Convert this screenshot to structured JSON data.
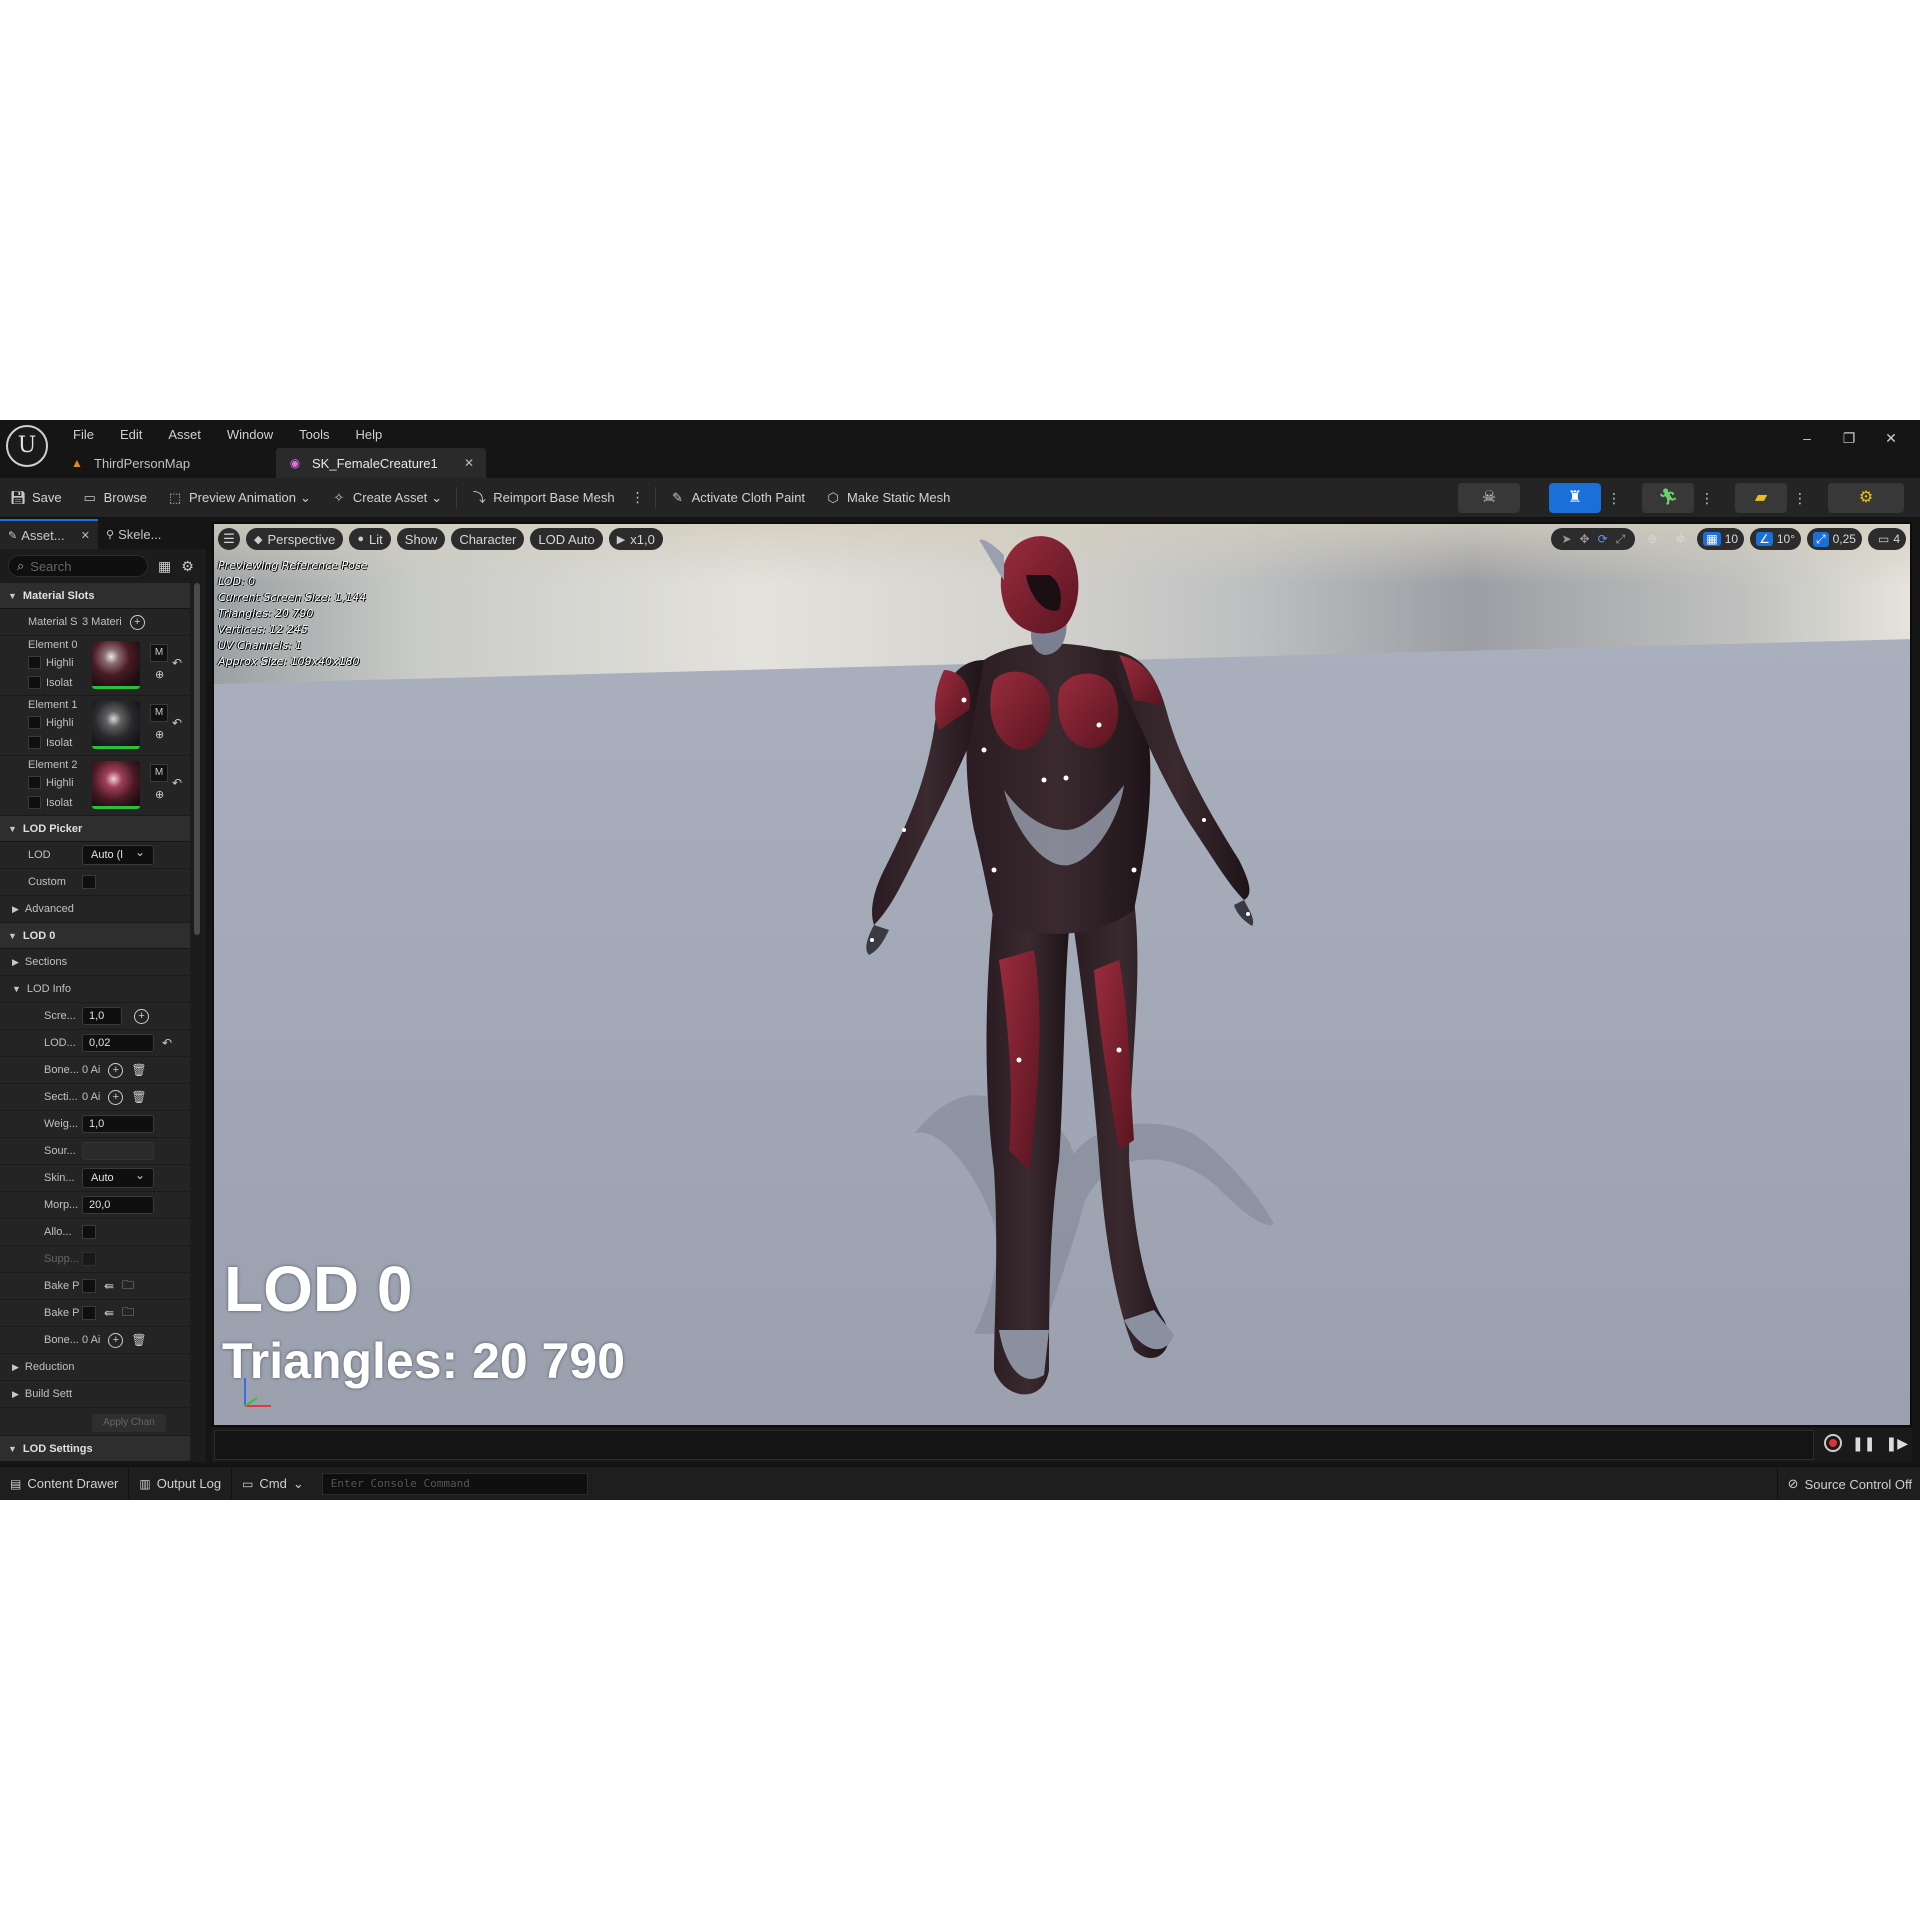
{
  "menu": [
    "File",
    "Edit",
    "Asset",
    "Window",
    "Tools",
    "Help"
  ],
  "tabs": [
    {
      "label": "ThirdPersonMap",
      "icon": "level-icon"
    },
    {
      "label": "SK_FemaleCreature1",
      "icon": "skeletal-mesh-icon"
    }
  ],
  "window_controls": {
    "minimize": "–",
    "restore": "❐",
    "close": "✕"
  },
  "toolbar": {
    "save": "Save",
    "browse": "Browse",
    "preview_animation": "Preview Animation",
    "create_asset": "Create Asset",
    "reimport": "Reimport Base Mesh",
    "cloth_paint": "Activate Cloth Paint",
    "make_static": "Make Static Mesh"
  },
  "panel_tabs": {
    "assets": "Asset...",
    "skeleton": "Skele..."
  },
  "search": {
    "placeholder": "Search"
  },
  "material_slots": {
    "title": "Material Slots",
    "label": "Material S",
    "value": "3 Materi",
    "elements": [
      {
        "name": "Element 0",
        "highlight": "Highli",
        "isolate": "Isolat",
        "m": "M"
      },
      {
        "name": "Element 1",
        "highlight": "Highli",
        "isolate": "Isolat",
        "m": "M"
      },
      {
        "name": "Element 2",
        "highlight": "Highli",
        "isolate": "Isolat",
        "m": "M"
      }
    ]
  },
  "lod_picker": {
    "title": "LOD Picker",
    "lod_label": "LOD",
    "lod_value": "Auto (l",
    "custom_label": "Custom",
    "advanced_label": "Advanced"
  },
  "lod0": {
    "title": "LOD 0",
    "sections_label": "Sections",
    "lod_info_label": "LOD Info",
    "rows": {
      "screen_label": "Scre...",
      "screen_value": "1,0",
      "lod_label": "LOD...",
      "lod_value": "0,02",
      "bone1_label": "Bone...",
      "bone1_value": "0 Ai",
      "sect_label": "Secti...",
      "sect_value": "0 Ai",
      "weight_label": "Weig...",
      "weight_value": "1,0",
      "source_label": "Sour...",
      "skin_label": "Skin...",
      "skin_value": "Auto",
      "morph_label": "Morp...",
      "morph_value": "20,0",
      "allow_label": "Allo...",
      "supp_label": "Supp...",
      "bake1_label": "Bake P",
      "bake2_label": "Bake P",
      "bone2_label": "Bone...",
      "bone2_value": "0 Ai"
    },
    "reduction_label": "Reduction",
    "build_label": "Build Sett",
    "apply_label": "Apply Chan"
  },
  "lod_settings": {
    "title": "LOD Settings"
  },
  "viewport": {
    "perspective": "Perspective",
    "lit": "Lit",
    "show": "Show",
    "character": "Character",
    "lod_auto": "LOD Auto",
    "speed": "x1,0",
    "grid_snap": "10",
    "rot_snap": "10°",
    "scale_snap": "0,25",
    "cam_speed": "4",
    "stats": [
      "Previewing Reference Pose",
      "LOD: 0",
      "Current Screen Size: 1,144",
      "Triangles: 20 790",
      "Vertices: 12 245",
      "UV Channels: 1",
      "Approx Size: 109x40x180"
    ],
    "overlay_lod": "LOD 0",
    "overlay_triangles": "Triangles: 20 790"
  },
  "statusbar": {
    "content_drawer": "Content Drawer",
    "output_log": "Output Log",
    "cmd": "Cmd",
    "console_placeholder": "Enter Console Command",
    "source_control": "Source Control Off"
  },
  "colors": {
    "accent": "#1a6fd8",
    "material_ok": "#2cbf3c",
    "suit_red": "#7a1c2a",
    "record": "#dd3333"
  }
}
